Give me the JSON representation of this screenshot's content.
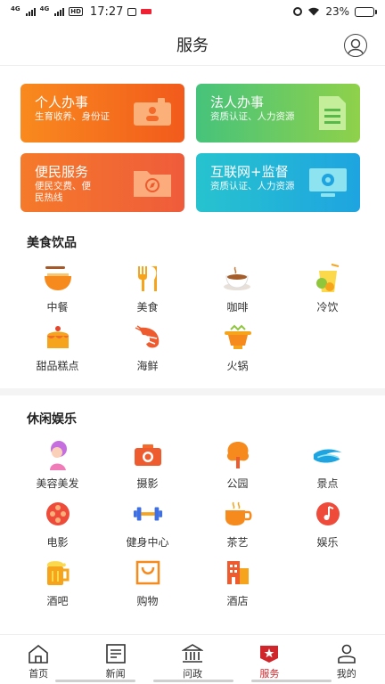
{
  "status_bar": {
    "net1": "4G",
    "net2": "4G",
    "hd": "HD",
    "time": "17:27",
    "battery": "23%",
    "battery_level": 0.23
  },
  "header": {
    "title": "服务"
  },
  "cards": [
    {
      "title": "个人办事",
      "subtitle": "生育收养、身份证"
    },
    {
      "title": "法人办事",
      "subtitle": "资质认证、人力资源"
    },
    {
      "title": "便民服务",
      "subtitle": "便民交费、便民热线"
    },
    {
      "title": "互联网+监督",
      "subtitle": "资质认证、人力资源"
    }
  ],
  "food": {
    "title": "美食饮品",
    "items": [
      {
        "label": "中餐",
        "icon": "noodle-bowl-icon"
      },
      {
        "label": "美食",
        "icon": "fork-knife-icon"
      },
      {
        "label": "咖啡",
        "icon": "coffee-cup-icon"
      },
      {
        "label": "冷饮",
        "icon": "cold-drink-icon"
      },
      {
        "label": "甜品糕点",
        "icon": "cake-icon"
      },
      {
        "label": "海鲜",
        "icon": "shrimp-icon"
      },
      {
        "label": "火锅",
        "icon": "hotpot-icon"
      }
    ]
  },
  "leisure": {
    "title": "休闲娱乐",
    "items": [
      {
        "label": "美容美发",
        "icon": "beauty-icon"
      },
      {
        "label": "摄影",
        "icon": "camera-icon"
      },
      {
        "label": "公园",
        "icon": "tree-icon"
      },
      {
        "label": "景点",
        "icon": "scenic-wave-icon"
      },
      {
        "label": "电影",
        "icon": "film-reel-icon"
      },
      {
        "label": "健身中心",
        "icon": "dumbbell-icon"
      },
      {
        "label": "茶艺",
        "icon": "tea-cup-icon"
      },
      {
        "label": "娱乐",
        "icon": "music-note-icon"
      },
      {
        "label": "酒吧",
        "icon": "beer-icon"
      },
      {
        "label": "购物",
        "icon": "shopping-bag-icon"
      },
      {
        "label": "酒店",
        "icon": "hotel-building-icon"
      }
    ]
  },
  "nav": [
    {
      "label": "首页",
      "icon": "home-icon"
    },
    {
      "label": "新闻",
      "icon": "news-icon"
    },
    {
      "label": "问政",
      "icon": "government-building-icon"
    },
    {
      "label": "服务",
      "icon": "service-star-icon",
      "active": true
    },
    {
      "label": "我的",
      "icon": "profile-icon"
    }
  ],
  "colors": {
    "accent_red": "#d0262b",
    "orange": "#f57a2a",
    "green": "#46c37b",
    "cyan": "#1ea4e0"
  }
}
